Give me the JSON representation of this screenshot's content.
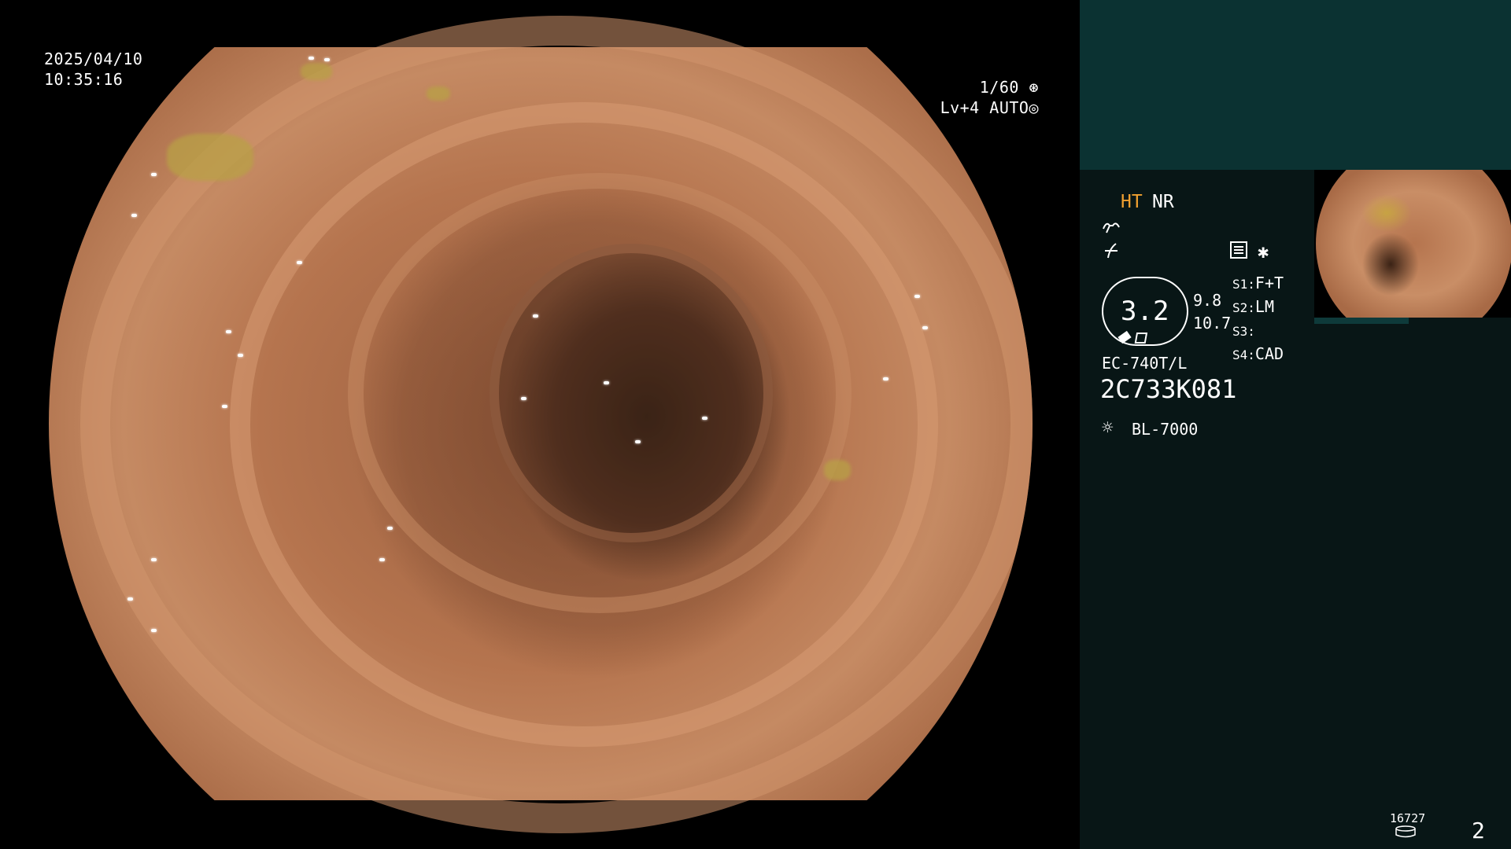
{
  "osd_left": {
    "date": "2025/04/10",
    "time": "10:35:16"
  },
  "osd_right": {
    "shutter": "1/60",
    "level": "Lv+4",
    "iris": "AUTO"
  },
  "panel": {
    "mode_ht": "HT",
    "mode_nr": "NR",
    "cap_value": "3.2",
    "side_value_1": "9.8",
    "side_value_2": "10.7",
    "switches": [
      {
        "key": "S1:",
        "value": "F+T"
      },
      {
        "key": "S2:",
        "value": "LM"
      },
      {
        "key": "S3:",
        "value": ""
      },
      {
        "key": "S4:",
        "value": "CAD"
      }
    ],
    "scope_model": "EC-740T/L",
    "scope_serial": "2C733K081",
    "light_source": "BL-7000",
    "counter": "16727",
    "page_number": "2"
  },
  "colors": {
    "panel_bg": "#081616",
    "header_bg": "#0b3232",
    "ht_accent": "#f0a030"
  },
  "icons": [
    "shutter-icon",
    "iris-icon",
    "enhance-curve-icon",
    "color-curve-icon",
    "settings-card-icon",
    "asterisk-icon",
    "lamp-icon",
    "storage-icon"
  ]
}
